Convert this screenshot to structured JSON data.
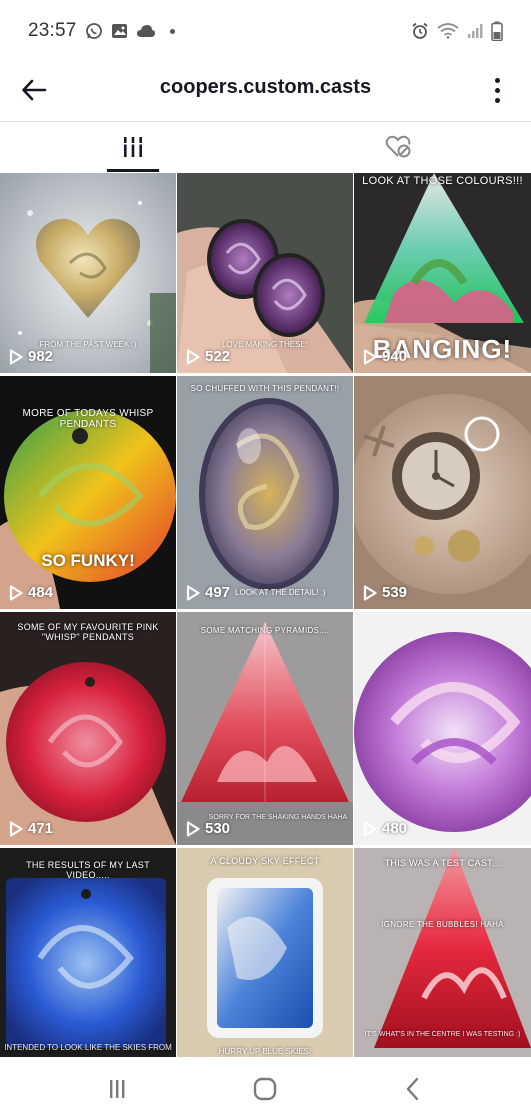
{
  "status_bar": {
    "time": "23:57",
    "icons": [
      "whatsapp-icon",
      "gallery-icon",
      "cloud-icon",
      "dot-icon",
      "alarm-icon",
      "wifi-icon",
      "signal-icon",
      "battery-icon"
    ]
  },
  "header": {
    "title": "coopers.custom.casts",
    "back_icon": "arrow-left-icon",
    "more_icon": "more-vertical-icon"
  },
  "tabs": [
    {
      "name": "videos",
      "icon": "grid-icon",
      "active": true
    },
    {
      "name": "liked",
      "icon": "hidden-heart-icon",
      "active": false
    }
  ],
  "videos": [
    {
      "views": "982",
      "caption_top": "",
      "caption_bottom": "FROM THE PAST WEEK :)",
      "big_text": "",
      "palette": [
        "#d8dde3",
        "#b9bfc6",
        "#c9a85b"
      ]
    },
    {
      "views": "522",
      "caption_top": "",
      "caption_bottom": "LOVE MAKING THESE!",
      "big_text": "",
      "palette": [
        "#e0b8a5",
        "#6a3e7a",
        "#2c2030"
      ]
    },
    {
      "views": "940",
      "caption_top": "LOOK AT THOSE COLOURS!!!",
      "caption_bottom": "",
      "big_text": "BANGING!",
      "palette": [
        "#2e2b2b",
        "#22c95a",
        "#e45a8a"
      ]
    },
    {
      "views": "484",
      "caption_top": "MORE OF TODAYS WHISP PENDANTS",
      "caption_bottom": "",
      "big_text": "SO FUNKY!",
      "palette": [
        "#2fa04a",
        "#f0c21b",
        "#e23b2b"
      ]
    },
    {
      "views": "497",
      "caption_top": "SO CHUFFED WITH THIS PENDANT!!",
      "caption_bottom": "LOOK AT THE DETAIL! :)",
      "big_text": "",
      "palette": [
        "#8a7b96",
        "#c8a04a",
        "#3f3a55"
      ]
    },
    {
      "views": "539",
      "caption_top": "",
      "caption_bottom": "",
      "big_text": "",
      "palette": [
        "#a88a75",
        "#d7c6b4",
        "#5b4a3e"
      ]
    },
    {
      "views": "471",
      "caption_top": "SOME OF MY FAVOURITE PINK \"WHISP\" PENDANTS",
      "caption_bottom": "",
      "big_text": "",
      "palette": [
        "#d8213d",
        "#f08da0",
        "#6a2b2b"
      ]
    },
    {
      "views": "530",
      "caption_top": "SOME MATCHING PYRAMIDS....",
      "caption_bottom": "SORRY FOR THE SHAKING HANDS HAHA",
      "big_text": "",
      "palette": [
        "#e04a5a",
        "#f3a0a6",
        "#8e8e8e"
      ]
    },
    {
      "views": "480",
      "caption_top": "",
      "caption_bottom": "",
      "big_text": "",
      "palette": [
        "#a64fc4",
        "#d9a0e6",
        "#f2f2f2"
      ]
    },
    {
      "views": "",
      "caption_top": "THE RESULTS OF MY LAST VIDEO.....",
      "caption_bottom": "INTENDED TO LOOK LIKE THE SKIES FROM",
      "big_text": "",
      "palette": [
        "#2a5bd4",
        "#9cc2f2",
        "#1a2f80"
      ]
    },
    {
      "views": "",
      "caption_top": "A CLOUDY SKY EFFECT",
      "caption_bottom": "HURRY UP BLUE SKIES!",
      "big_text": "",
      "palette": [
        "#d8cbb0",
        "#2c6ad0",
        "#f2f2f4"
      ]
    },
    {
      "views": "",
      "caption_top": "THIS WAS A TEST CAST...",
      "caption_bottom": "IT'S WHAT'S IN THE CENTRE I WAS TESTING :)",
      "big_text": "",
      "extra_caption": "IGNORE THE BUBBLES! HAHA",
      "palette": [
        "#e6283e",
        "#f59aa3",
        "#b9b3b4"
      ]
    }
  ],
  "nav_bar": {
    "recents_icon": "recents-icon",
    "home_icon": "home-icon",
    "back_icon": "nav-back-icon"
  }
}
